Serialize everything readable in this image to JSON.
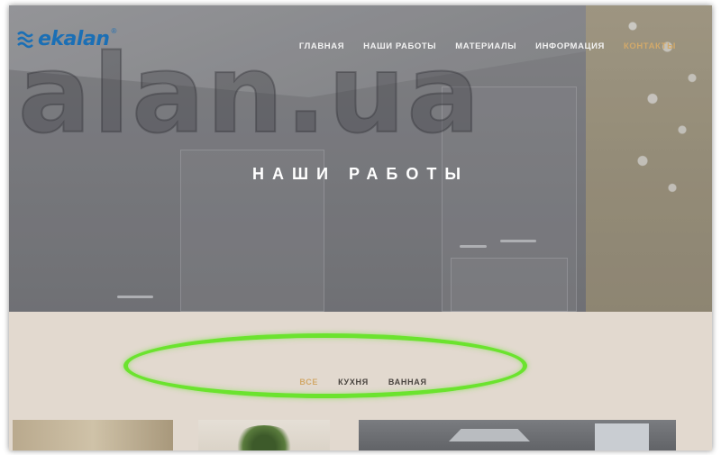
{
  "logo": {
    "text": "ekalan",
    "reg": "®",
    "color": "#1b6fb5"
  },
  "watermark": "alan.ua",
  "nav": {
    "items": [
      {
        "label": "ГЛАВНАЯ",
        "active": false
      },
      {
        "label": "НАШИ РАБОТЫ",
        "active": false
      },
      {
        "label": "МАТЕРИАЛЫ",
        "active": false
      },
      {
        "label": "ИНФОРМАЦИЯ",
        "active": false
      },
      {
        "label": "КОНТАКТЫ",
        "active": true
      }
    ]
  },
  "hero": {
    "title": "НАШИ РАБОТЫ"
  },
  "filters": {
    "items": [
      {
        "label": "ВСЕ",
        "active": true
      },
      {
        "label": "КУХНЯ",
        "active": false
      },
      {
        "label": "ВАННАЯ",
        "active": false
      }
    ]
  },
  "colors": {
    "accent": "#d2a96a",
    "highlight_ring": "#6be32e",
    "section_bg": "#e2d9cf"
  }
}
